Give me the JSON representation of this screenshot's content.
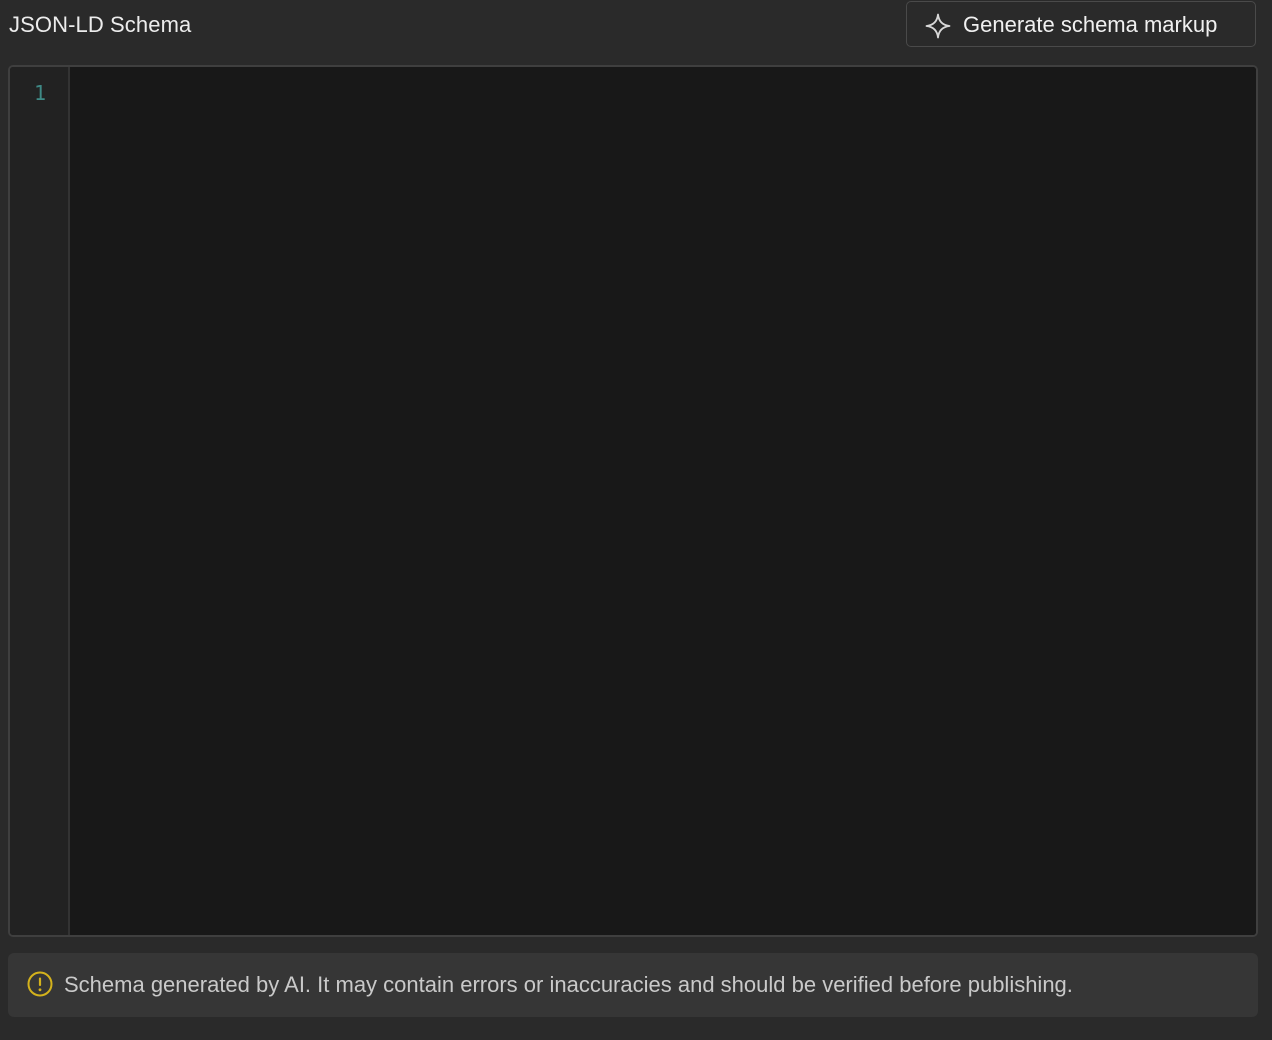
{
  "header": {
    "title": "JSON-LD Schema",
    "generate_button": {
      "label": "Generate schema markup",
      "icon": "sparkle-icon"
    }
  },
  "editor": {
    "line_numbers": [
      "1"
    ],
    "content": "",
    "line_number_color": "#3f8a86",
    "background": "#181818"
  },
  "notice": {
    "icon": "warning-icon",
    "icon_color": "#d4b21c",
    "text": "Schema generated by AI. It may contain errors or inaccuracies and should be verified before publishing."
  }
}
